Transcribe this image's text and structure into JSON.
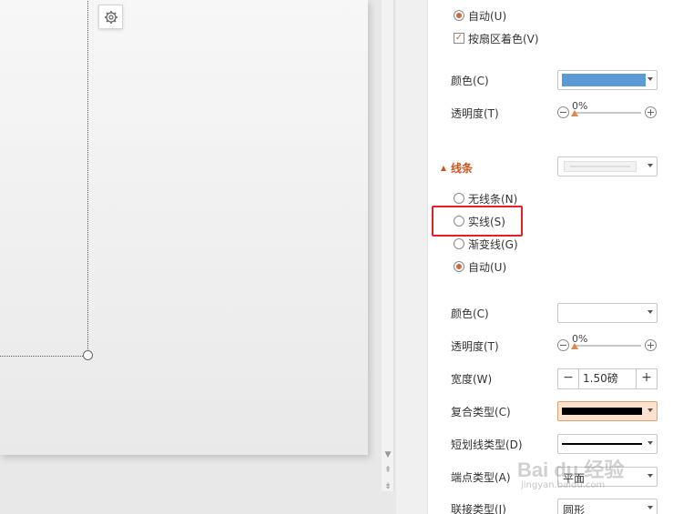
{
  "fill": {
    "auto_radio": "自动(U)",
    "vary_colors_checkbox": "按扇区着色(V)",
    "color_label": "颜色(C)",
    "color_swatch": "#5b9bd5",
    "transparency_label": "透明度(T)",
    "transparency_value": "0%"
  },
  "line": {
    "section_title": "线条",
    "no_line": "无线条(N)",
    "solid_line": "实线(S)",
    "gradient_line": "渐变线(G)",
    "auto": "自动(U)",
    "color_label": "颜色(C)",
    "transparency_label": "透明度(T)",
    "transparency_value": "0%",
    "width_label": "宽度(W)",
    "width_value": "1.50磅",
    "compound_label": "复合类型(C)",
    "dash_label": "短划线类型(D)",
    "cap_label": "端点类型(A)",
    "cap_value": "平面",
    "join_label": "联接类型(J)",
    "join_value": "圆形"
  },
  "icons": {
    "settings": "gear-icon",
    "accent_color": "#c7561f",
    "highlight_color": "#e3202a"
  },
  "watermark": {
    "brand": "Bai du 经验",
    "sub": "jingyan.baidu.com"
  }
}
